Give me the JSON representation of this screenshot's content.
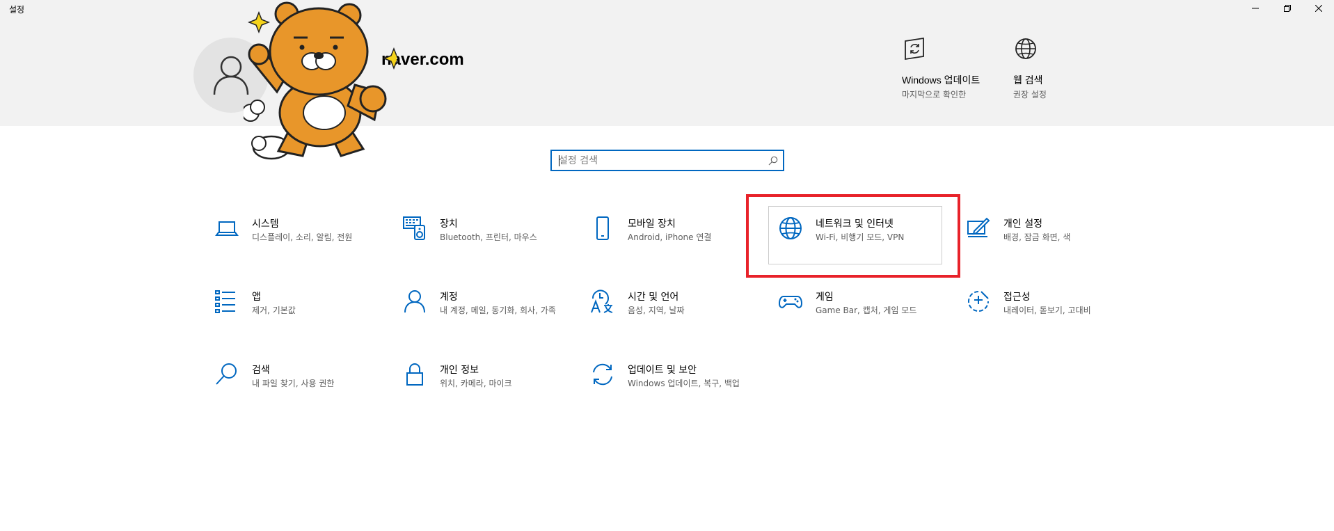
{
  "window": {
    "title": "설정",
    "controls": {
      "minimize": "minimize",
      "restore": "restore",
      "close": "close"
    }
  },
  "account": {
    "email_visible": "naver.com"
  },
  "quick_links": [
    {
      "title": "Windows 업데이트",
      "subtitle": "마지막으로 확인한",
      "icon": "windows-update-icon"
    },
    {
      "title": "웹 검색",
      "subtitle": "권장 설정",
      "icon": "globe-icon"
    }
  ],
  "search": {
    "placeholder": "설정 검색"
  },
  "tiles": [
    {
      "name": "시스템",
      "desc": "디스플레이, 소리, 알림, 전원",
      "icon": "laptop-icon"
    },
    {
      "name": "장치",
      "desc": "Bluetooth, 프린터, 마우스",
      "icon": "devices-icon"
    },
    {
      "name": "모바일 장치",
      "desc": "Android, iPhone 연결",
      "icon": "phone-icon"
    },
    {
      "name": "네트워크 및 인터넷",
      "desc": "Wi-Fi, 비행기 모드, VPN",
      "icon": "globe-icon"
    },
    {
      "name": "개인 설정",
      "desc": "배경, 잠금 화면, 색",
      "icon": "personalization-icon"
    },
    {
      "name": "앱",
      "desc": "제거, 기본값",
      "icon": "apps-icon"
    },
    {
      "name": "계정",
      "desc": "내 계정, 메일, 동기화, 회사, 가족",
      "icon": "person-icon"
    },
    {
      "name": "시간 및 언어",
      "desc": "음성, 지역, 날짜",
      "icon": "time-language-icon"
    },
    {
      "name": "게임",
      "desc": "Game Bar, 캡처, 게임 모드",
      "icon": "gamepad-icon"
    },
    {
      "name": "접근성",
      "desc": "내레이터, 돋보기, 고대비",
      "icon": "accessibility-icon"
    },
    {
      "name": "검색",
      "desc": "내 파일 찾기, 사용 권한",
      "icon": "search-icon"
    },
    {
      "name": "개인 정보",
      "desc": "위치, 카메라, 마이크",
      "icon": "lock-icon"
    },
    {
      "name": "업데이트 및 보안",
      "desc": "Windows 업데이트, 복구, 백업",
      "icon": "sync-icon"
    }
  ],
  "colors": {
    "accent": "#0067c0",
    "header_bg": "#f2f2f2",
    "highlight": "#e8222a",
    "sticker_body": "#e8962a"
  }
}
